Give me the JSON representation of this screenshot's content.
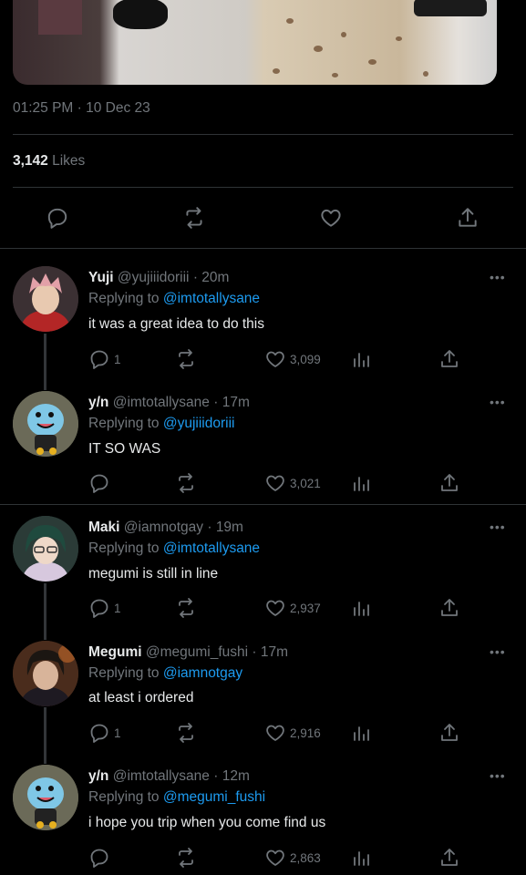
{
  "main_tweet": {
    "timestamp": "01:25 PM · 10 Dec 23",
    "likes_count": "3,142",
    "likes_label": "Likes"
  },
  "replies": [
    {
      "name": "Yuji",
      "handle": "@yujiiidoriii",
      "time": "20m",
      "replying_label": "Replying to",
      "replying_to": "@imtotallysane",
      "text": "it was a great idea to do this",
      "reply_count": "1",
      "like_count": "3,099",
      "avatar": "pink-haired-character"
    },
    {
      "name": "y/n",
      "handle": "@imtotallysane",
      "time": "17m",
      "replying_label": "Replying to",
      "replying_to": "@yujiiidoriii",
      "text": "IT SO WAS",
      "reply_count": "",
      "like_count": "3,021",
      "avatar": "blue-pokemon-character"
    },
    {
      "name": "Maki",
      "handle": "@iamnotgay",
      "time": "19m",
      "replying_label": "Replying to",
      "replying_to": "@imtotallysane",
      "text": "megumi is still in line",
      "reply_count": "1",
      "like_count": "2,937",
      "avatar": "green-haired-glasses-character"
    },
    {
      "name": "Megumi",
      "handle": "@megumi_fushi",
      "time": "17m",
      "replying_label": "Replying to",
      "replying_to": "@iamnotgay",
      "text": "at least i ordered",
      "reply_count": "1",
      "like_count": "2,916",
      "avatar": "dark-haired-character"
    },
    {
      "name": "y/n",
      "handle": "@imtotallysane",
      "time": "12m",
      "replying_label": "Replying to",
      "replying_to": "@megumi_fushi",
      "text": "i hope you trip when you come find us",
      "reply_count": "",
      "like_count": "2,863",
      "avatar": "blue-pokemon-character"
    }
  ],
  "colors": {
    "background": "#000000",
    "muted": "#71767b",
    "link": "#1d9bf0",
    "text": "#e7e9ea"
  }
}
